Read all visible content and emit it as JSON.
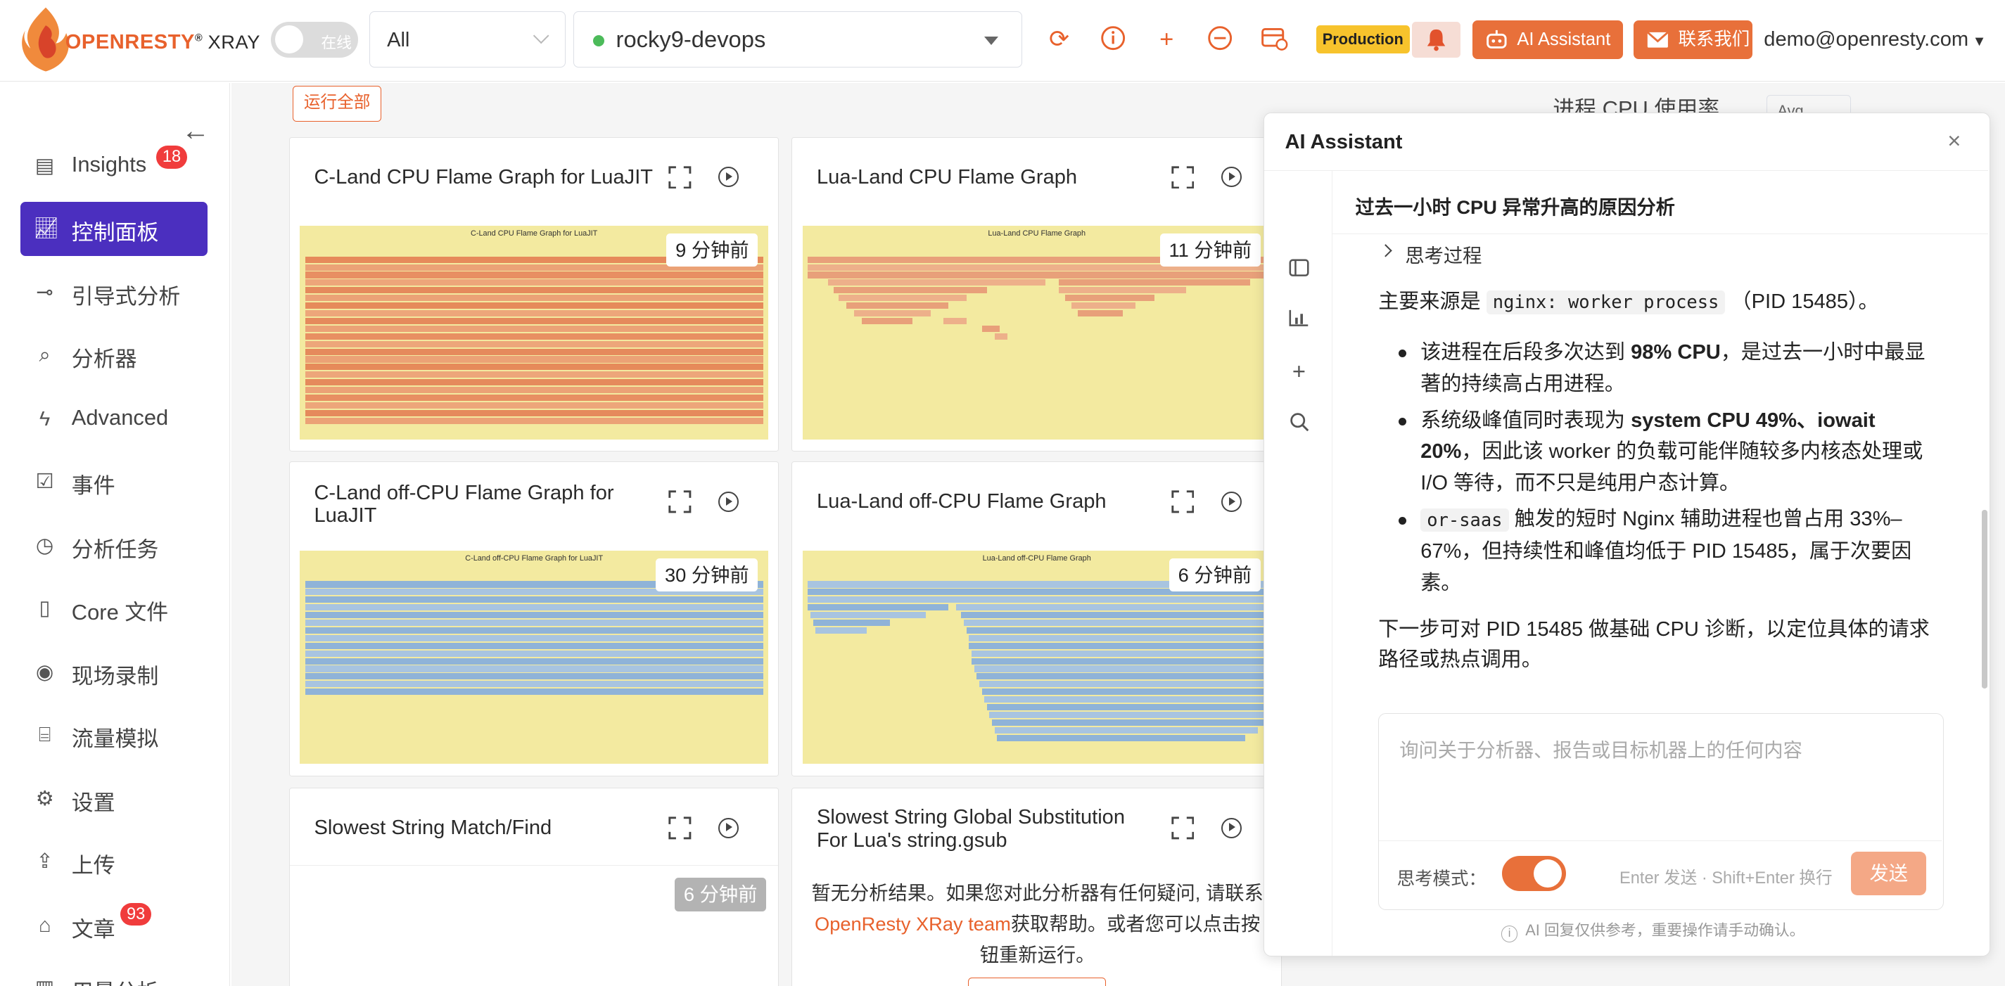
{
  "header": {
    "brand_pre": "OPENRESTY",
    "brand_r": "®",
    "brand_product": "XRAY",
    "online_label": "在线",
    "filter_value": "All",
    "machine_value": "rocky9-devops",
    "env_badge": "Production",
    "ai_button": "AI Assistant",
    "contact_button": "联系我们",
    "user": "demo@openresty.com"
  },
  "sidebar": {
    "items": [
      {
        "label": "Insights",
        "badge": "18"
      },
      {
        "label": "控制面板"
      },
      {
        "label": "引导式分析"
      },
      {
        "label": "分析器"
      },
      {
        "label": "Advanced"
      },
      {
        "label": "事件"
      },
      {
        "label": "分析任务"
      },
      {
        "label": "Core 文件"
      },
      {
        "label": "现场录制"
      },
      {
        "label": "流量模拟"
      },
      {
        "label": "设置"
      },
      {
        "label": "上传"
      },
      {
        "label": "文章",
        "badge": "93"
      },
      {
        "label": "用量分析"
      }
    ]
  },
  "main": {
    "run_all": "运行全部",
    "cpu_heading": "进程 CPU 使用率",
    "avg_select": "Avg",
    "cards": [
      {
        "title": "C-Land CPU Flame Graph for LuaJIT",
        "time": "9 分钟前",
        "graph_title": "C-Land CPU Flame Graph for LuaJIT"
      },
      {
        "title": "Lua-Land CPU Flame Graph",
        "time": "11 分钟前",
        "graph_title": "Lua-Land CPU Flame Graph"
      },
      {
        "title": "C-Land off-CPU Flame Graph for LuaJIT",
        "time": "30 分钟前",
        "graph_title": "C-Land off-CPU Flame Graph for LuaJIT"
      },
      {
        "title": "Lua-Land off-CPU Flame Graph",
        "time": "6 分钟前",
        "graph_title": "Lua-Land off-CPU Flame Graph"
      },
      {
        "title": "Slowest String Match/Find",
        "time": "6 分钟前"
      },
      {
        "title": "Slowest String Global Substitution For Lua's string.gsub",
        "empty_pre": "暂无分析结果。如果您对此分析器有任何疑问, 请联系",
        "empty_link": "OpenResty XRay team",
        "empty_post": "获取帮助。或者您可以点击按钮重新运行。"
      }
    ]
  },
  "ai": {
    "title": "AI Assistant",
    "conversation_title": "过去一小时 CPU 异常升高的原因分析",
    "thinking": "思考过程",
    "main_source_pre": "主要来源是",
    "main_source_code": "nginx: worker process",
    "main_source_post": "（PID 15485）。",
    "b1_pre": "该进程在后段多次达到",
    "b1_strong": "98% CPU",
    "b1_post": "，是过去一小时中最显著的持续高占用进程。",
    "b2_pre": "系统级峰值同时表现为",
    "b2_strong": "system CPU 49%、iowait 20%",
    "b2_post": "，因此该 worker 的负载可能伴随较多内核态处理或 I/O 等待，而不只是纯用户态计算。",
    "b3_code": "or-saas",
    "b3_post": "触发的短时 Nginx 辅助进程也曾占用 33%–67%，但持续性和峰值均低于 PID 15485，属于次要因素。",
    "next_step": "下一步可对 PID 15485 做基础 CPU 诊断，以定位具体的请求路径或热点调用。",
    "input_placeholder": "询问关于分析器、报告或目标机器上的任何内容",
    "think_mode_label": "思考模式：",
    "think_mode_on": true,
    "hint": "Enter 发送 · Shift+Enter 换行",
    "send": "发送",
    "disclaimer": "AI 回复仅供参考，重要操作请手动确认。"
  },
  "colors": {
    "accent": "#e8612c",
    "active_nav": "#4b2fbf",
    "production": "#f7c32c",
    "flame_bg": "#f3eaa0"
  }
}
